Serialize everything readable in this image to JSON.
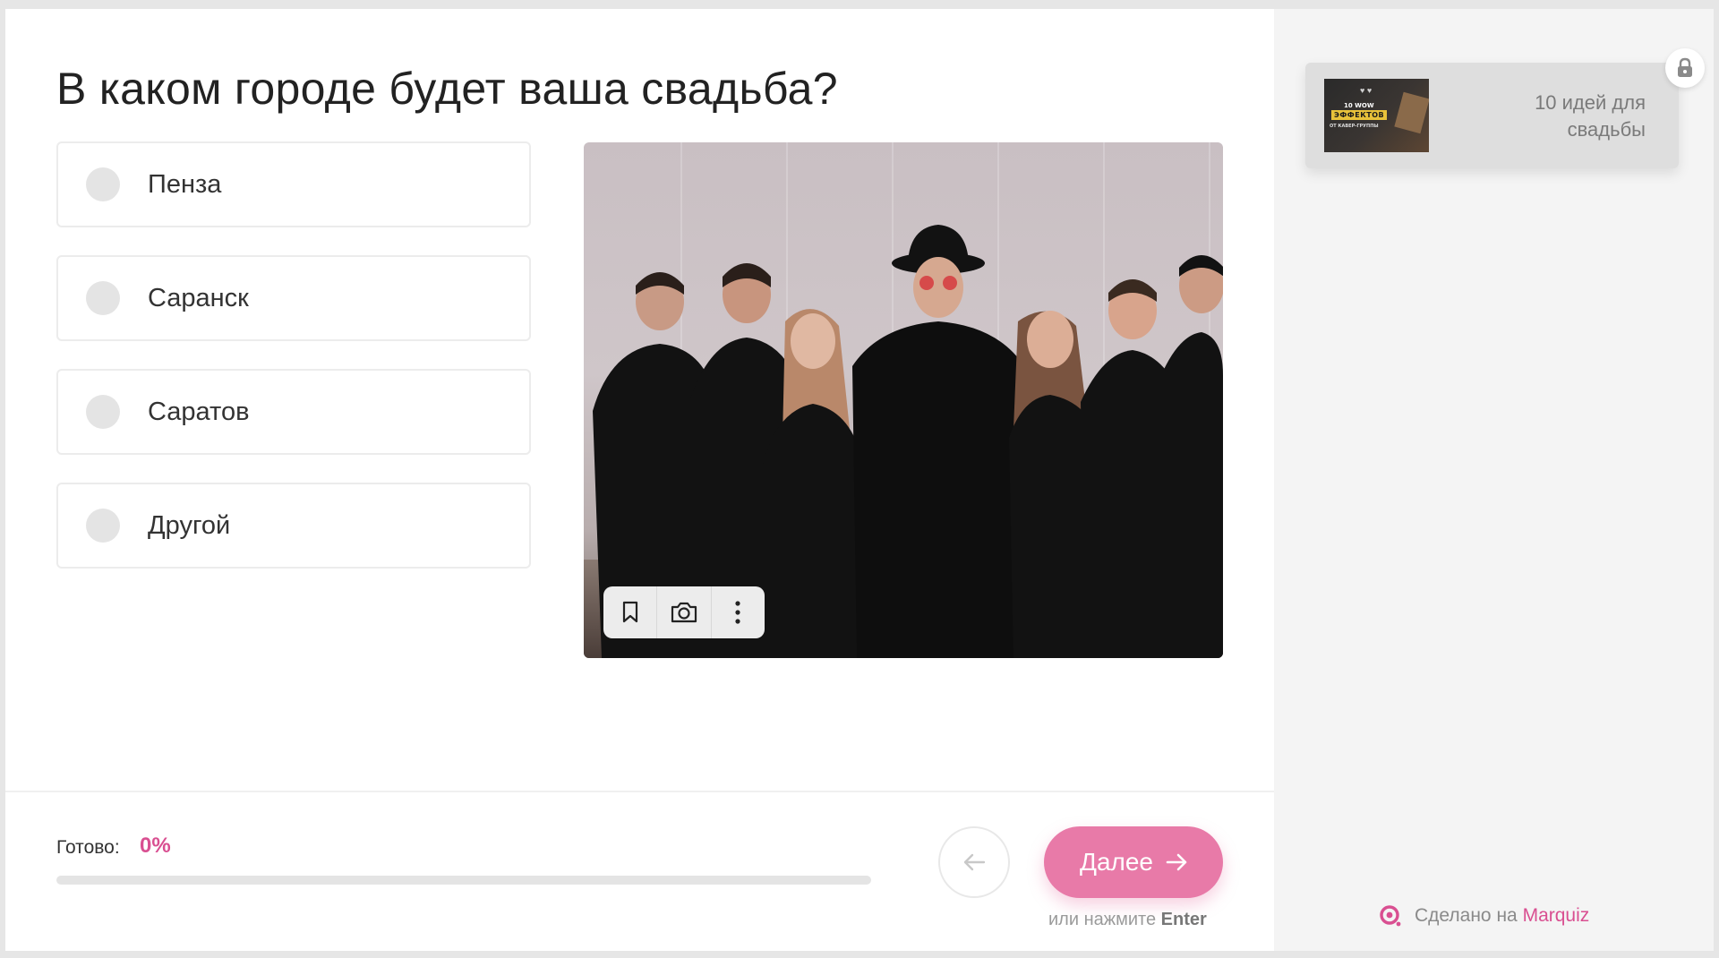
{
  "question": {
    "title": "В каком городе будет ваша свадьба?"
  },
  "options": [
    {
      "label": "Пенза"
    },
    {
      "label": "Саранск"
    },
    {
      "label": "Саратов"
    },
    {
      "label": "Другой"
    }
  ],
  "photo_toolbar": {
    "icons": [
      "bookmark-icon",
      "camera-icon",
      "more-vertical-icon"
    ]
  },
  "progress": {
    "label": "Готово:",
    "value_text": "0%",
    "value": 0
  },
  "navigation": {
    "next_label": "Далее",
    "hint_prefix": "или нажмите",
    "hint_key": "Enter"
  },
  "sidebar": {
    "bonus_card": {
      "title": "10 идей для свадьбы",
      "thumb_line1": "10 WOW",
      "thumb_line2": "ЭФФЕКТОВ",
      "thumb_line3": "ОТ КАВЕР-ГРУППЫ"
    },
    "made_on": {
      "prefix": "Сделано на",
      "brand": "Marquiz"
    }
  },
  "colors": {
    "accent": "#d94f91",
    "next_button": "#e87aa8",
    "sidebar_bg": "#f4f4f4"
  }
}
